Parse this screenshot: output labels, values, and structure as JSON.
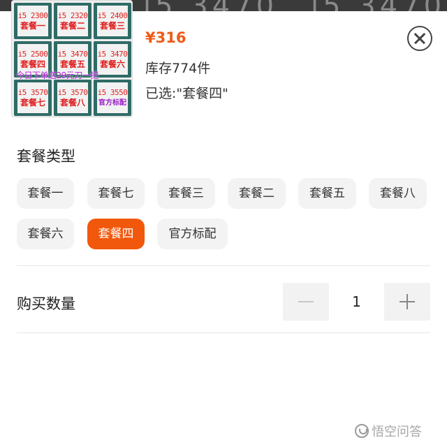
{
  "product": {
    "thumbnail": {
      "chips": [
        {
          "model": "i5 2300",
          "package": "套餐一"
        },
        {
          "model": "i5 2320",
          "package": "套餐二"
        },
        {
          "model": "i5 2400",
          "package": "套餐三"
        },
        {
          "model": "i5 2500",
          "package": "套餐四"
        },
        {
          "model": "i5 3470",
          "package": "套餐五"
        },
        {
          "model": "i5 3470",
          "package": "套餐六"
        },
        {
          "model": "i5 3570",
          "package": "套餐七"
        },
        {
          "model": "i5 3570",
          "package": "套餐八"
        },
        {
          "model": "i5 3550",
          "package": "官方标配"
        }
      ],
      "promo": "今日下单送29元刀一把"
    },
    "price": "¥316",
    "stock": "库存774件",
    "selected": "已选:\"套餐四\""
  },
  "close_icon": "close-circle-icon",
  "options_section": {
    "title": "套餐类型",
    "options": [
      {
        "label": "套餐一",
        "active": false
      },
      {
        "label": "套餐七",
        "active": false
      },
      {
        "label": "套餐三",
        "active": false
      },
      {
        "label": "套餐二",
        "active": false
      },
      {
        "label": "套餐五",
        "active": false
      },
      {
        "label": "套餐八",
        "active": false
      },
      {
        "label": "套餐六",
        "active": false
      },
      {
        "label": "套餐四",
        "active": true
      },
      {
        "label": "官方标配",
        "active": false
      }
    ]
  },
  "quantity": {
    "label": "购买数量",
    "value": "1",
    "minus_icon": "minus-icon",
    "plus_icon": "plus-icon"
  },
  "watermark": {
    "text": "悟空问答"
  },
  "colors": {
    "accent": "#f2580c",
    "price": "#f05a16",
    "option_bg": "#f3f3f3"
  }
}
